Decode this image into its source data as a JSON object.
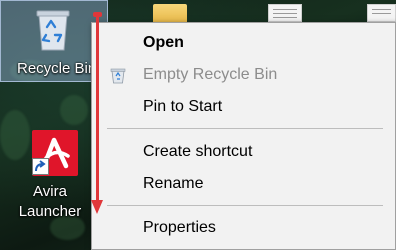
{
  "desktop": {
    "icons": [
      {
        "label": "Recycle Bin",
        "icon": "recycle-bin-icon"
      },
      {
        "label": "Avira Launcher",
        "label_line1": "Avira",
        "label_line2": "Launcher",
        "icon": "avira-icon"
      }
    ]
  },
  "context_menu": {
    "items": [
      {
        "label": "Open",
        "bold": true,
        "disabled": false
      },
      {
        "label": "Empty Recycle Bin",
        "bold": false,
        "disabled": true,
        "icon": "recycle-bin-small-icon"
      },
      {
        "label": "Pin to Start",
        "bold": false,
        "disabled": false
      },
      {
        "label": "Create shortcut",
        "bold": false,
        "disabled": false
      },
      {
        "label": "Rename",
        "bold": false,
        "disabled": false
      },
      {
        "label": "Properties",
        "bold": false,
        "disabled": false
      }
    ]
  },
  "colors": {
    "annotation_arrow": "#e0373a",
    "menu_background": "#f2f2f2",
    "disabled_text": "#8c8c8c"
  }
}
